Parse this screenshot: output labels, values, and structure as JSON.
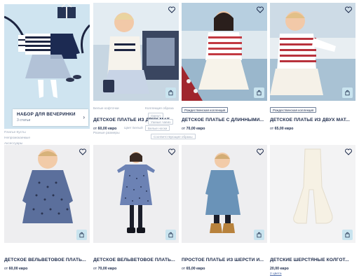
{
  "set": {
    "title": "НАБОР ДЛЯ ВЕЧЕРИНКИ",
    "subtitle": "3 статьи",
    "ghost_lines": [
      "Платье Кусты",
      "Непромокаемые",
      "Аксессуары"
    ]
  },
  "row1": [
    {
      "title": "ДЕТСКОЕ ПЛАТЬЕ ИЗ ДВУХ МАТ...",
      "price_prefix": "от",
      "price": "60,00 евро",
      "ghost": [
        "Белые кофточки",
        "Коллекция образа",
        "Цвет Белый",
        "Разные размеры"
      ],
      "ghost_tags": [
        "Ореол",
        "Ушные чаеиз",
        "Белые носки",
        "Соответствующие образы"
      ]
    },
    {
      "tag": "Рождественская коллекция",
      "title": "ДЕТСКОЕ ПЛАТЬЕ С ДЛИННЫМИ...",
      "price_prefix": "от",
      "price": "70,00 евро"
    },
    {
      "tag": "Рождественская коллекция",
      "title": "ДЕТСКОЕ ПЛАТЬЕ ИЗ ДВУХ МАТ...",
      "price_prefix": "от",
      "price": "65,00 евро"
    }
  ],
  "row2": [
    {
      "title": "ДЕТСКОЕ ВЕЛЬВЕТОВОЕ ПЛАТЬ...",
      "price_prefix": "от",
      "price": "60,00 евро"
    },
    {
      "title": "ДЕТСКОЕ ВЕЛЬВЕТОВОЕ ПЛАТЬ...",
      "price_prefix": "от",
      "price": "70,00 евро"
    },
    {
      "title": "ПРОСТОЕ ПЛАТЬЕ ИЗ ШЕРСТИ И...",
      "price_prefix": "от",
      "price": "65,00 евро"
    },
    {
      "title": "ДЕТСКИЕ ШЕРСТЯНЫЕ КОЛГОТ...",
      "price_prefix": "",
      "price": "20,00 евро",
      "more": "2 цвета"
    }
  ],
  "colors": {
    "navy": "#1c2a4a",
    "cart_bg": "#c9e4ef",
    "studio_bg": "#eeeef0",
    "winter_bg": "#bcd4e4",
    "set_bg": "#cfe4f0"
  },
  "icons": [
    "heart-icon",
    "bag-icon",
    "chevron-right-icon"
  ]
}
